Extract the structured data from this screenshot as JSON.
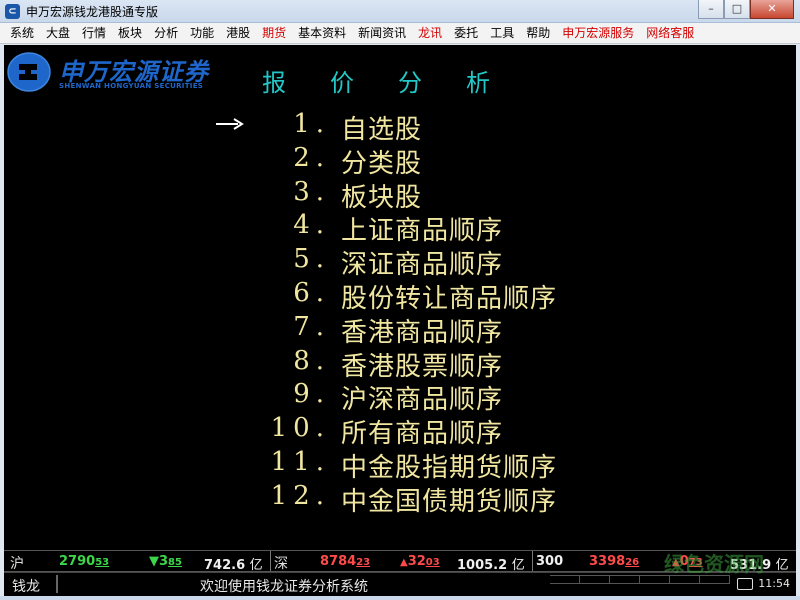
{
  "window": {
    "title": "申万宏源钱龙港股通专版",
    "min_label": "–",
    "max_label": "□",
    "close_label": "✕"
  },
  "menubar": [
    {
      "label": "系统",
      "color": "#000000"
    },
    {
      "label": "大盘",
      "color": "#000000"
    },
    {
      "label": "行情",
      "color": "#000000"
    },
    {
      "label": "板块",
      "color": "#000000"
    },
    {
      "label": "分析",
      "color": "#000000"
    },
    {
      "label": "功能",
      "color": "#000000"
    },
    {
      "label": "港股",
      "color": "#000000"
    },
    {
      "label": "期货",
      "color": "#d40000"
    },
    {
      "label": "基本资料",
      "color": "#000000"
    },
    {
      "label": "新闻资讯",
      "color": "#000000"
    },
    {
      "label": "龙讯",
      "color": "#d40000"
    },
    {
      "label": "委托",
      "color": "#000000"
    },
    {
      "label": "工具",
      "color": "#000000"
    },
    {
      "label": "帮助",
      "color": "#000000"
    },
    {
      "label": "申万宏源服务",
      "color": "#d40000"
    },
    {
      "label": "网络客服",
      "color": "#d40000"
    }
  ],
  "logo": {
    "name_cn": "申万宏源证券",
    "name_en": "SHENWAN HONGYUAN SECURITIES"
  },
  "screen_title": [
    "报",
    "价",
    "分",
    "析"
  ],
  "menu_items": [
    {
      "num": "1.",
      "label": "自选股"
    },
    {
      "num": "2.",
      "label": "分类股"
    },
    {
      "num": "3.",
      "label": "板块股"
    },
    {
      "num": "4.",
      "label": "上证商品顺序"
    },
    {
      "num": "5.",
      "label": "深证商品顺序"
    },
    {
      "num": "6.",
      "label": "股份转让商品顺序"
    },
    {
      "num": "7.",
      "label": "香港商品顺序"
    },
    {
      "num": "8.",
      "label": "香港股票顺序"
    },
    {
      "num": "9.",
      "label": "沪深商品顺序"
    },
    {
      "num": "10.",
      "label": "所有商品顺序"
    },
    {
      "num": "11.",
      "label": "中金股指期货顺序"
    },
    {
      "num": "12.",
      "label": "中金国债期货顺序"
    }
  ],
  "selected_index": 0,
  "ticker": {
    "sh_label": "沪",
    "sh_index_main": "2790",
    "sh_index_dec": "53",
    "sh_change_arrow": "▼",
    "sh_change_main": "3",
    "sh_change_dec": "85",
    "sh_volume": "742.6",
    "sh_unit": "亿",
    "sz_label": "深",
    "sz_index_main": "8784",
    "sz_index_dec": "23",
    "sz_change_arrow": "▲",
    "sz_change_main": "32",
    "sz_change_dec": "03",
    "sz_volume": "1005.2",
    "sz_unit": "亿",
    "c300_label": "300",
    "c300_index_main": "3398",
    "c300_index_dec": "26",
    "c300_change_arrow": "▲",
    "c300_change_main": "0",
    "c300_change_dec": "73",
    "c300_volume": "531.9",
    "c300_unit": "亿"
  },
  "statusbar": {
    "app_name": "钱龙",
    "welcome": "欢迎使用钱龙证券分析系统",
    "time": "11:54"
  },
  "watermark": "绿色资源网",
  "colors": {
    "menu_text": "#f0e6a0",
    "title_text": "#22c8c8",
    "up": "#ff4a4a",
    "down": "#3dd64a",
    "logo_blue": "#1e66c9"
  }
}
